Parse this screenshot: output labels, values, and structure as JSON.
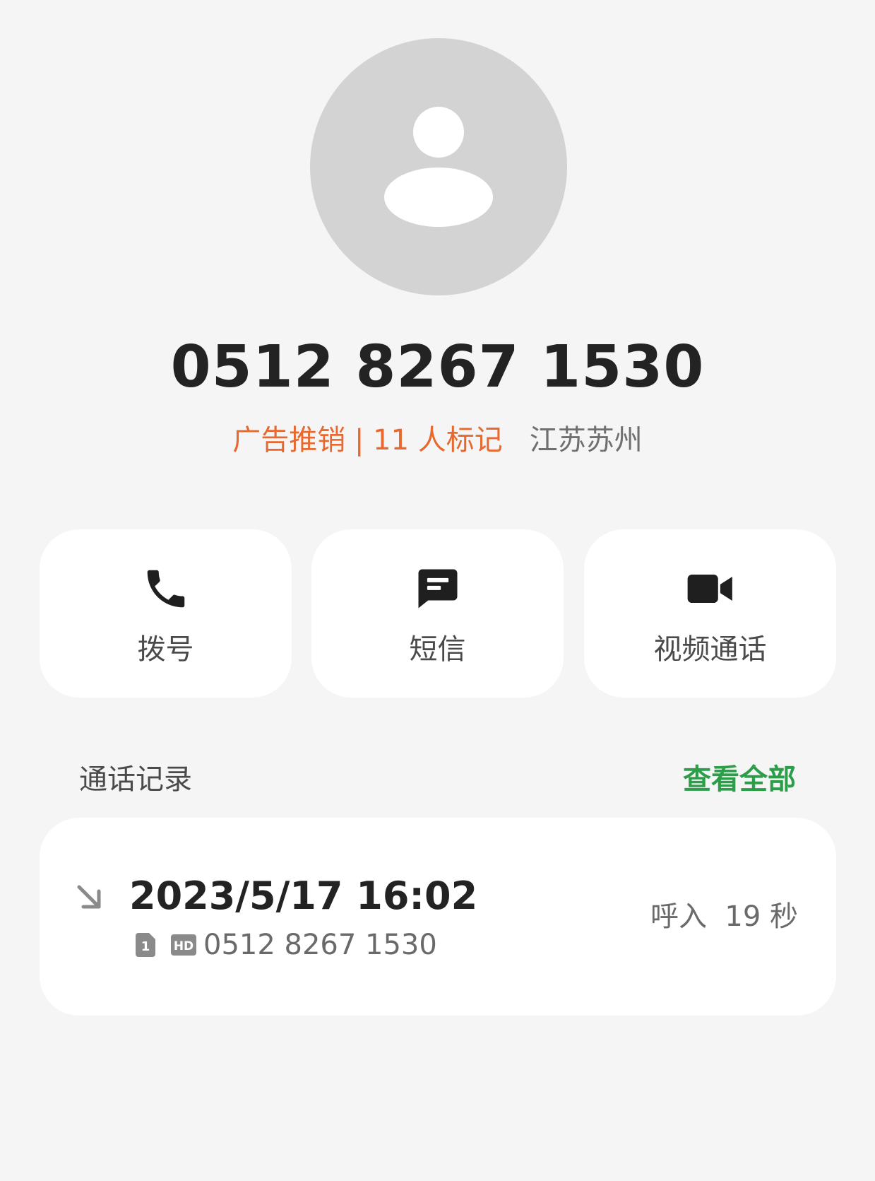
{
  "contact": {
    "phone": "0512 8267 1530",
    "mark_label": "广告推销 | 11 人标记",
    "location": "江苏苏州",
    "avatar_icon": "person-icon"
  },
  "actions": [
    {
      "label": "拨号",
      "icon": "phone-icon"
    },
    {
      "label": "短信",
      "icon": "message-icon"
    },
    {
      "label": "视频通话",
      "icon": "video-camera-icon"
    }
  ],
  "call_log": {
    "title": "通话记录",
    "view_all": "查看全部",
    "entries": [
      {
        "datetime": "2023/5/17 16:02",
        "number": "0512 8267 1530",
        "sim": "1",
        "hd": "HD",
        "status": "呼入  19 秒",
        "direction_icon": "incoming-arrow-icon"
      }
    ]
  },
  "colors": {
    "background": "#f5f5f5",
    "mark": "#e8692f",
    "accent_green": "#2c9e4a",
    "card": "#ffffff",
    "avatar_bg": "#d3d3d3"
  }
}
